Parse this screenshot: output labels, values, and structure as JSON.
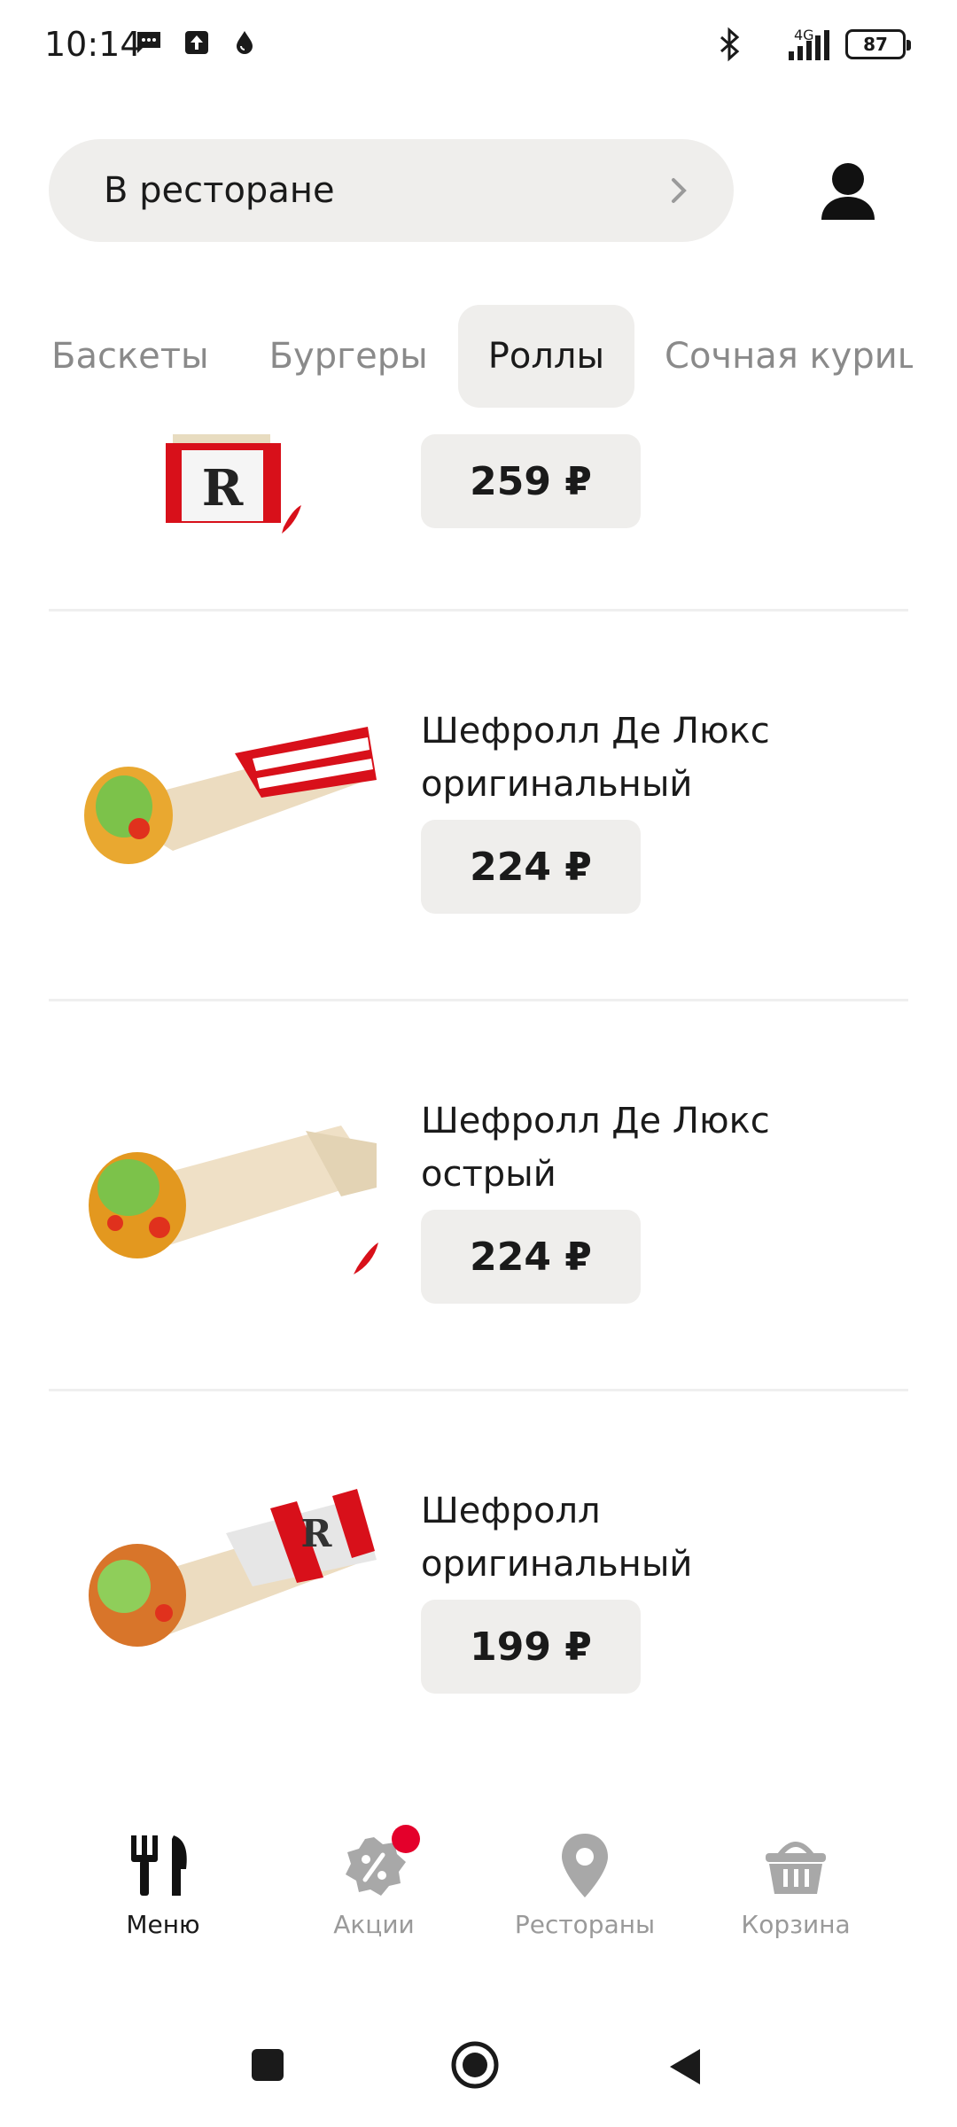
{
  "status_bar": {
    "time": "10:14",
    "network": "4G",
    "battery": "87"
  },
  "header": {
    "location_label": "В ресторане"
  },
  "tabs": [
    {
      "label": "Баскеты",
      "active": false
    },
    {
      "label": "Бургеры",
      "active": false
    },
    {
      "label": "Роллы",
      "active": true
    },
    {
      "label": "Сочная курица",
      "active": false
    }
  ],
  "products": [
    {
      "name": "",
      "price": "259 ₽",
      "spicy": true
    },
    {
      "name": "Шефролл Де Люкс оригинальный",
      "price": "224 ₽",
      "spicy": false
    },
    {
      "name": "Шефролл Де Люкс острый",
      "price": "224 ₽",
      "spicy": true
    },
    {
      "name": "Шефролл оригинальный",
      "price": "199 ₽",
      "spicy": false
    }
  ],
  "bottom_nav": [
    {
      "label": "Меню",
      "icon": "fork-knife-icon",
      "active": true
    },
    {
      "label": "Акции",
      "icon": "discount-icon",
      "active": false,
      "badge": true
    },
    {
      "label": "Рестораны",
      "icon": "map-pin-icon",
      "active": false
    },
    {
      "label": "Корзина",
      "icon": "basket-icon",
      "active": false
    }
  ],
  "colors": {
    "accent": "#e4002b",
    "pill_bg": "#efeeec",
    "text": "#1a1a1a",
    "muted": "#9a9a9a"
  }
}
